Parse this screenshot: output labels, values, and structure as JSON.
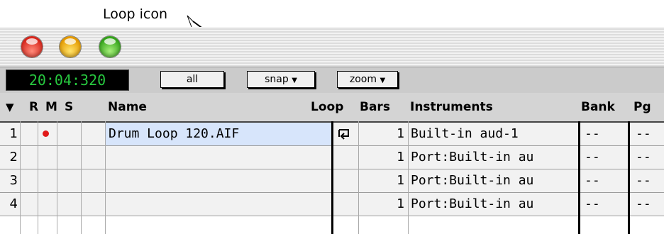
{
  "annotation": {
    "label": "Loop icon"
  },
  "window": {
    "controls": [
      "close",
      "minimize",
      "zoom"
    ]
  },
  "toolbar": {
    "time": "20:04:320",
    "all_label": "all",
    "snap_label": "snap",
    "zoom_label": "zoom"
  },
  "columns": {
    "record": "R",
    "mute": "M",
    "solo": "S",
    "name": "Name",
    "loop": "Loop",
    "bars": "Bars",
    "instruments": "Instruments",
    "bank": "Bank",
    "pgm": "Pg"
  },
  "tracks": [
    {
      "num": "1",
      "record": true,
      "name": "Drum Loop 120.AIF",
      "loop": true,
      "bars": "1",
      "instrument": "Built-in aud-1",
      "bank": "--",
      "pgm": "--"
    },
    {
      "num": "2",
      "record": false,
      "name": "",
      "loop": false,
      "bars": "1",
      "instrument": "Port:Built-in au",
      "bank": "--",
      "pgm": "--"
    },
    {
      "num": "3",
      "record": false,
      "name": "",
      "loop": false,
      "bars": "1",
      "instrument": "Port:Built-in au",
      "bank": "--",
      "pgm": "--"
    },
    {
      "num": "4",
      "record": false,
      "name": "",
      "loop": false,
      "bars": "1",
      "instrument": "Port:Built-in au",
      "bank": "--",
      "pgm": "--"
    }
  ],
  "colors": {
    "time_text": "#27c93f",
    "selected_name_bg": "#d7e5fb",
    "record_dot": "#e11a1a"
  }
}
